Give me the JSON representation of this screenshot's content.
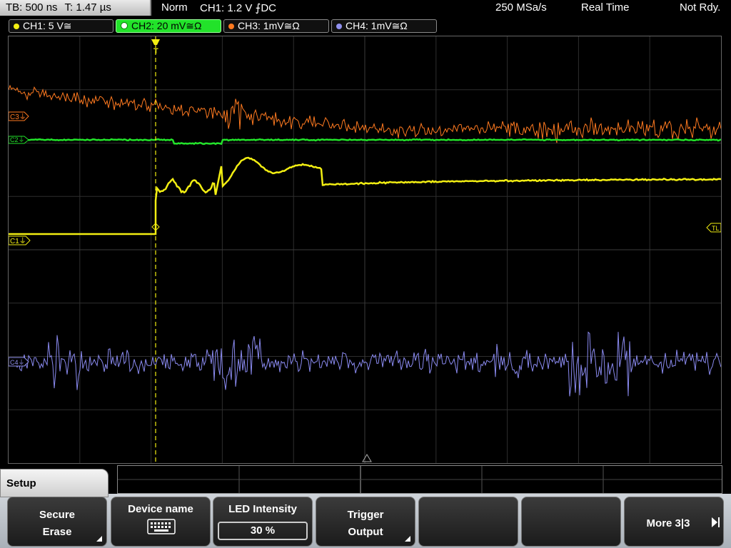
{
  "top": {
    "timebase": "TB: 500 ns",
    "trigger_time": "T: 1.47 µs",
    "mode": "Norm",
    "trigger_setting": "CH1: 1.2 V ⨍DC",
    "sample_rate": "250 MSa/s",
    "acq_mode": "Real Time",
    "status": "Not Rdy."
  },
  "channels": [
    {
      "label": "CH1: 5 V≅",
      "color": "#f2ee12",
      "active": false
    },
    {
      "label": "CH2: 20 mV≅Ω",
      "color": "#22e22a",
      "active": true
    },
    {
      "label": "CH3: 1mV≅Ω",
      "color": "#ff7a20",
      "active": false
    },
    {
      "label": "CH4: 1mV≅Ω",
      "color": "#9090ee",
      "active": false
    }
  ],
  "markers": {
    "c1": "C1⏚",
    "c2": "C2⏚",
    "c3": "C3⏚",
    "c4": "C4⏚",
    "trigger_level": "TL",
    "trigger_pos": "T"
  },
  "waveforms": {
    "ch1_level_before": "low",
    "ch1_level_after": "high",
    "ch2": "flat with small dip near trigger",
    "ch3": "noisy, decaying",
    "ch4": "noise bursts"
  },
  "menu": {
    "title": "Setup",
    "softkeys": [
      {
        "line1": "Secure",
        "line2": "Erase"
      },
      {
        "line1": "Device name",
        "line2": ""
      },
      {
        "line1": "LED Intensity",
        "line2": "30 %"
      },
      {
        "line1": "Trigger",
        "line2": "Output"
      },
      {
        "line1": "",
        "line2": ""
      },
      {
        "line1": "",
        "line2": ""
      },
      {
        "line1": "More 3|3",
        "line2": ""
      }
    ]
  }
}
